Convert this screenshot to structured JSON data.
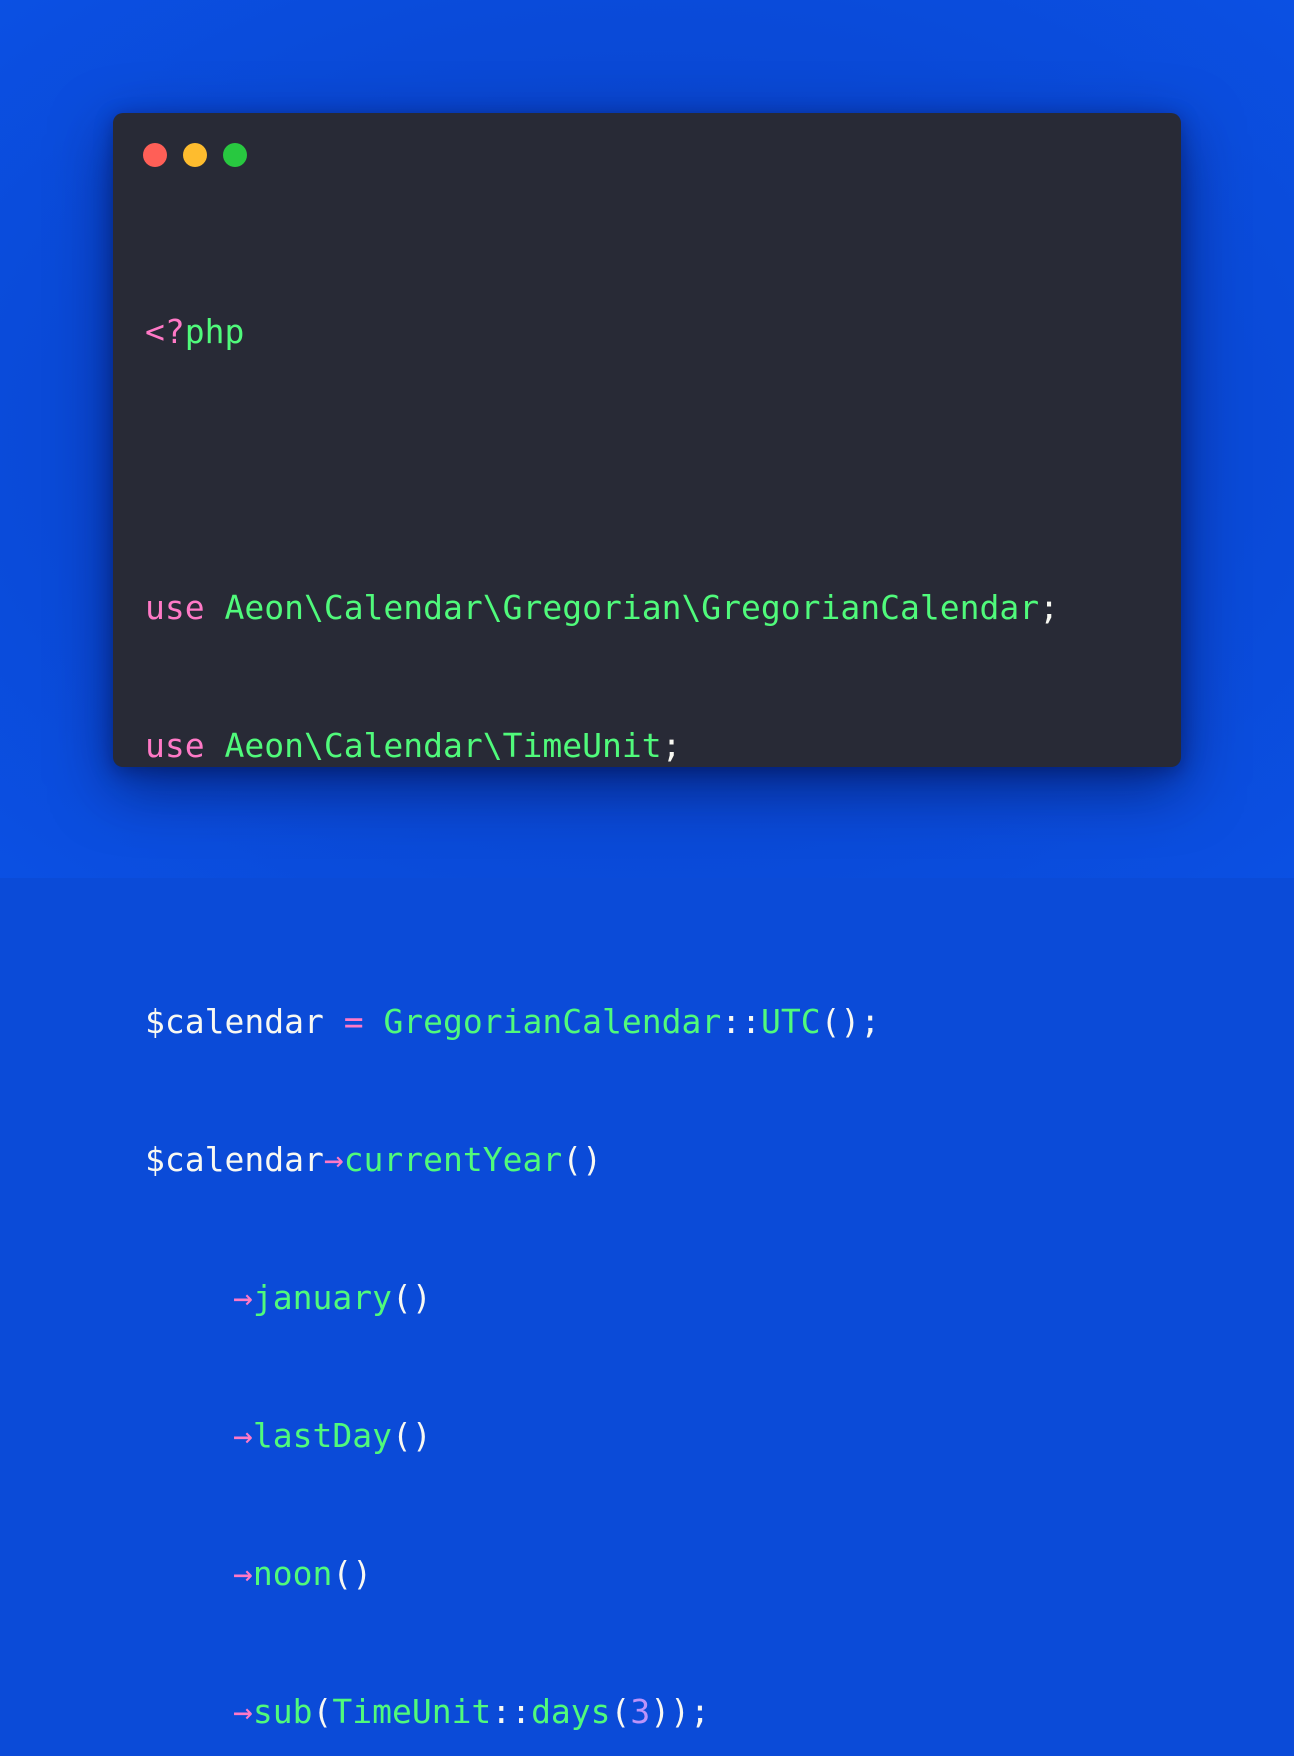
{
  "window": {
    "controls": {
      "close_color": "#ff5f57",
      "minimize_color": "#febc2e",
      "maximize_color": "#28c840"
    }
  },
  "colors": {
    "background": "#0b4bd8",
    "editor": "#282a36",
    "keyword": "#ff79c6",
    "identifier": "#50fa7b",
    "number": "#bd93f9",
    "plain": "#f8f8f2"
  },
  "code": {
    "open_tag_lt": "<?",
    "open_tag_php": "php",
    "use1": {
      "keyword": "use",
      "path": "Aeon\\Calendar\\Gregorian\\GregorianCalendar",
      "end": ";"
    },
    "use2": {
      "keyword": "use",
      "path": "Aeon\\Calendar\\TimeUnit",
      "end": ";"
    },
    "assign": {
      "var": "$calendar",
      "eq": "=",
      "class": "GregorianCalendar",
      "sep": "::",
      "method": "UTC",
      "end": "();"
    },
    "chain_start": {
      "var": "$calendar",
      "arrow": "→",
      "method": "currentYear",
      "parens": "()"
    },
    "chain": [
      {
        "arrow": "→",
        "method": "january",
        "parens": "()"
      },
      {
        "arrow": "→",
        "method": "lastDay",
        "parens": "()"
      },
      {
        "arrow": "→",
        "method": "noon",
        "parens": "()"
      }
    ],
    "chain_last": {
      "arrow": "→",
      "method": "sub",
      "open": "(",
      "class": "TimeUnit",
      "sep": "::",
      "inner_method": "days",
      "inner_open": "(",
      "arg": "3",
      "close": "));"
    }
  }
}
